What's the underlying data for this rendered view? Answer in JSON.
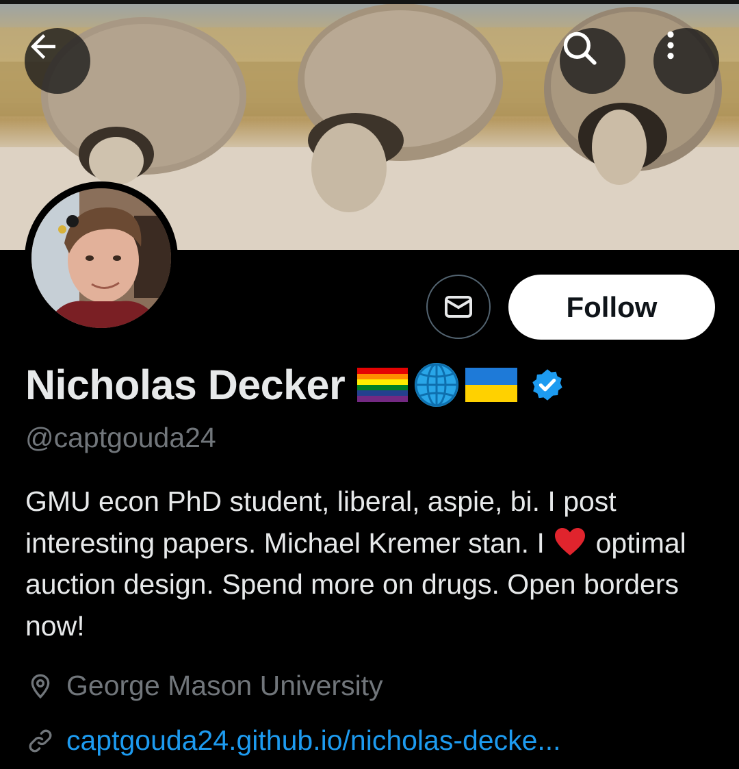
{
  "header": {
    "back_icon": "arrow-left-icon",
    "search_icon": "search-icon",
    "more_icon": "more-vertical-icon"
  },
  "banner": {
    "description_icon": "banner-image"
  },
  "actions": {
    "message_icon": "envelope-icon",
    "follow_label": "Follow"
  },
  "profile": {
    "display_name": "Nicholas Decker",
    "name_emojis": [
      "rainbow-flag-icon",
      "globe-icon",
      "ukraine-flag-icon"
    ],
    "verified_icon": "verified-badge-icon",
    "handle": "@captgouda24",
    "bio_part1": "GMU econ PhD student, liberal, aspie, bi. I post interesting papers. Michael Kremer stan. I ",
    "bio_heart_icon": "red-heart-icon",
    "bio_part2": " optimal auction design. Spend more on drugs. Open borders now!",
    "location": "George Mason University",
    "url": "captgouda24.github.io/nicholas-decke..."
  },
  "colors": {
    "background": "#000000",
    "text_primary": "#e7e9ea",
    "text_secondary": "#71767b",
    "link": "#1d9bf0",
    "verified": "#1d9bf0",
    "follow_bg": "#ffffff"
  }
}
